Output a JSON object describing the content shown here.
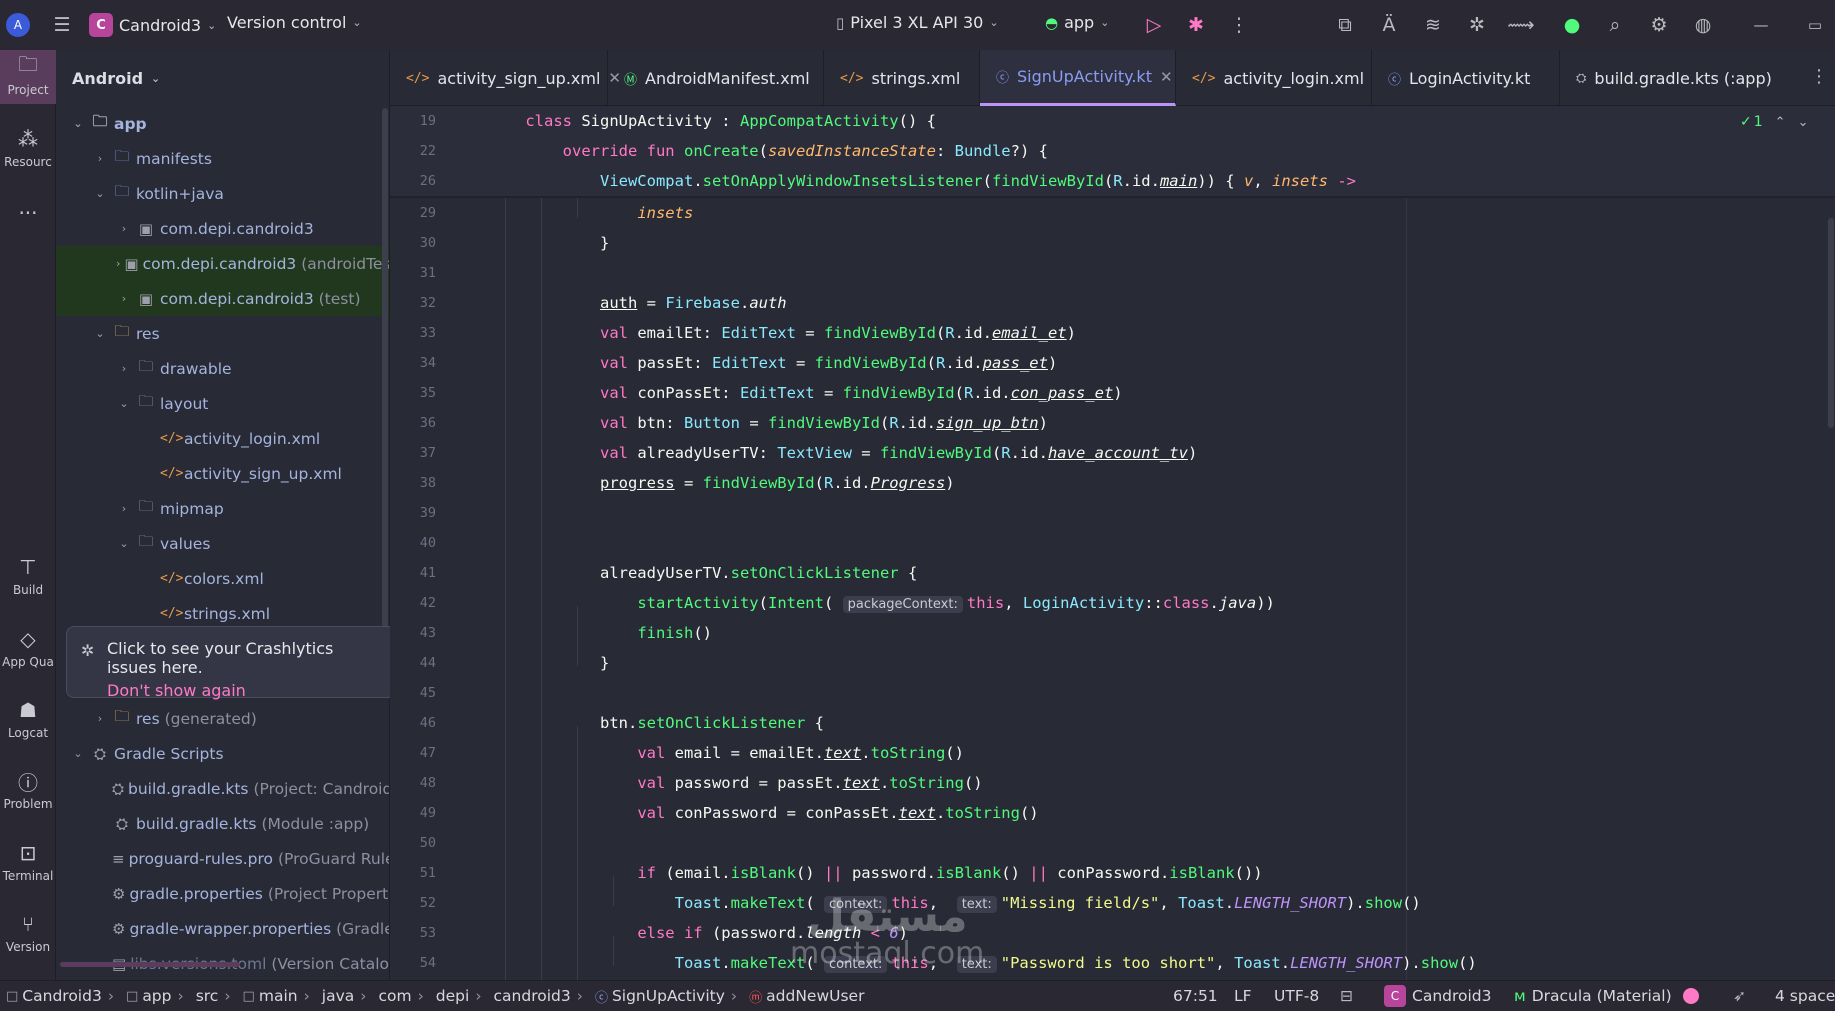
{
  "topbar": {
    "project_initial": "C",
    "project_name": "Candroid3",
    "vcs": "Version control",
    "device": "Pixel 3 XL API 30",
    "run_config": "app"
  },
  "strip": {
    "project": "Project",
    "resources": "Resourc",
    "build": "Build",
    "app_quality": "App Qua",
    "logcat": "Logcat",
    "problems": "Problem",
    "terminal": "Terminal",
    "version": "Version"
  },
  "panel": {
    "title": "Android",
    "tree": [
      {
        "label": "app",
        "extra": ""
      },
      {
        "label": "manifests",
        "extra": ""
      },
      {
        "label": "kotlin+java",
        "extra": ""
      },
      {
        "label": "com.depi.candroid3",
        "extra": ""
      },
      {
        "label": "com.depi.candroid3",
        "extra": "(androidTest"
      },
      {
        "label": "com.depi.candroid3",
        "extra": "(test)"
      },
      {
        "label": "res",
        "extra": ""
      },
      {
        "label": "drawable",
        "extra": ""
      },
      {
        "label": "layout",
        "extra": ""
      },
      {
        "label": "activity_login.xml",
        "extra": ""
      },
      {
        "label": "activity_sign_up.xml",
        "extra": ""
      },
      {
        "label": "mipmap",
        "extra": ""
      },
      {
        "label": "values",
        "extra": ""
      },
      {
        "label": "colors.xml",
        "extra": ""
      },
      {
        "label": "strings.xml",
        "extra": ""
      },
      {
        "label": "res",
        "extra": "(generated)"
      },
      {
        "label": "Gradle Scripts",
        "extra": ""
      },
      {
        "label": "build.gradle.kts",
        "extra": "(Project: Candroid3)"
      },
      {
        "label": "build.gradle.kts",
        "extra": "(Module :app)"
      },
      {
        "label": "proguard-rules.pro",
        "extra": "(ProGuard Rules f"
      },
      {
        "label": "gradle.properties",
        "extra": "(Project Properties"
      },
      {
        "label": "gradle-wrapper.properties",
        "extra": "(Gradle Ve"
      },
      {
        "label": "libs.versions.toml",
        "extra": "(Version Catalog)"
      }
    ]
  },
  "popup": {
    "message": "Click to see your Crashlytics issues here.",
    "link": "Don't show again"
  },
  "tabs": [
    {
      "label": "activity_sign_up.xml"
    },
    {
      "label": "AndroidManifest.xml"
    },
    {
      "label": "strings.xml"
    },
    {
      "label": "SignUpActivity.kt"
    },
    {
      "label": "activity_login.xml"
    },
    {
      "label": "LoginActivity.kt"
    },
    {
      "label": "build.gradle.kts (:app)"
    }
  ],
  "editor": {
    "inspections": "1",
    "line_numbers": [
      "19",
      "22",
      "26",
      "29",
      "30",
      "31",
      "32",
      "33",
      "34",
      "35",
      "36",
      "37",
      "38",
      "39",
      "40",
      "41",
      "42",
      "43",
      "44",
      "45",
      "46",
      "47",
      "48",
      "49",
      "50",
      "51",
      "52",
      "53",
      "54"
    ],
    "hints": {
      "package_context": "packageContext:",
      "context": "context:",
      "text": "text:"
    },
    "strings": {
      "missing": "\"Missing field/s\"",
      "short": "\"Password is too short\""
    }
  },
  "status": {
    "breadcrumbs": [
      "Candroid3",
      "app",
      "src",
      "main",
      "java",
      "com",
      "depi",
      "candroid3",
      "SignUpActivity",
      "addNewUser"
    ],
    "position": "67:51",
    "line_sep": "LF",
    "encoding": "UTF-8",
    "project_initial": "C",
    "project": "Candroid3",
    "theme": "Dracula (Material)",
    "indent": "4 spaces"
  },
  "watermark": {
    "arabic": "مستقل",
    "latin": "mostaql.com"
  }
}
